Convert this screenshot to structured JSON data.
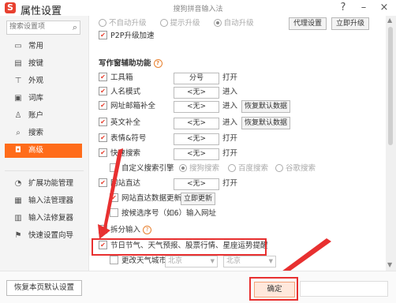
{
  "window": {
    "title": "属性设置",
    "subtitle": "搜狗拼音输入法",
    "help": "?",
    "minimize": "–",
    "close": "×"
  },
  "sidebar": {
    "search_placeholder": "搜索设置项",
    "items": [
      {
        "label": "常用",
        "icon": "monitor-icon",
        "glyph": "▭"
      },
      {
        "label": "按键",
        "icon": "keyboard-icon",
        "glyph": "▤"
      },
      {
        "label": "外观",
        "icon": "shirt-icon",
        "glyph": "⊤"
      },
      {
        "label": "词库",
        "icon": "book-icon",
        "glyph": "▣"
      },
      {
        "label": "账户",
        "icon": "user-icon",
        "glyph": "♙"
      },
      {
        "label": "搜索",
        "icon": "search-icon",
        "glyph": "⌕"
      },
      {
        "label": "高级",
        "icon": "advanced-icon",
        "glyph": "◘"
      },
      {
        "label": "扩展功能管理",
        "icon": "extension-icon",
        "glyph": "◔"
      },
      {
        "label": "输入法管理器",
        "icon": "manager-icon",
        "glyph": "▦"
      },
      {
        "label": "输入法修复器",
        "icon": "repair-icon",
        "glyph": "▥"
      },
      {
        "label": "快速设置向导",
        "icon": "wizard-icon",
        "glyph": "⚑"
      }
    ]
  },
  "upgrade": {
    "options": [
      "不自动升级",
      "提示升级",
      "自动升级"
    ],
    "selected": "自动升级",
    "proxy_button": "代理设置",
    "upgrade_now_button": "立即升级",
    "p2p_label": "P2P升级加速"
  },
  "assist": {
    "title": "写作窗辅助功能",
    "help": "?",
    "rows": [
      {
        "label": "工具箱",
        "value": "分号",
        "action": "打开"
      },
      {
        "label": "人名模式",
        "value": "<无>",
        "action": "进入"
      },
      {
        "label": "网址邮箱补全",
        "value": "<无>",
        "action": "进入",
        "button": "恢复默认数据"
      },
      {
        "label": "英文补全",
        "value": "<无>",
        "action": "进入",
        "button": "恢复默认数据"
      },
      {
        "label": "表情&符号",
        "value": "<无>",
        "action": "打开"
      },
      {
        "label": "快速搜索",
        "value": "<无>",
        "action": "打开"
      }
    ],
    "custom_engine_label": "自定义搜索引擎",
    "engines": [
      "搜狗搜索",
      "百度搜索",
      "谷歌搜索"
    ],
    "site_direct": {
      "label": "网站直达",
      "value": "<无>",
      "action": "打开"
    },
    "site_update_label": "网站直达数据更新",
    "update_now_button": "立即更新",
    "select_key_label": "按候选序号（如6）输入网址",
    "split_input_label": "拆分输入",
    "split_help": "?",
    "festival_label": "节日节气、天气预报、股票行情、星座运势提醒",
    "weather_city_label": "更改天气城市",
    "province": "北京",
    "city": "北京"
  },
  "footer": {
    "restore_defaults": "恢复本页默认设置",
    "ok": "确定"
  },
  "colors": {
    "accent": "#ff6c1a",
    "brand": "#e8402f",
    "highlight": "#e83030"
  }
}
